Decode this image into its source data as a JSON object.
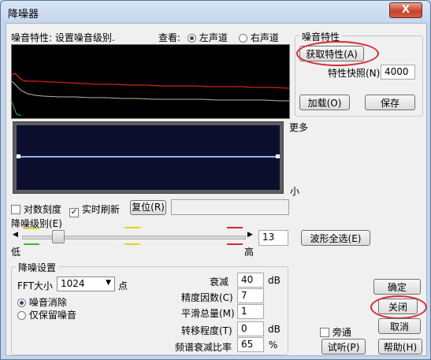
{
  "window": {
    "title": "降噪器",
    "close_glyph": "X"
  },
  "spectrum": {
    "label": "噪音特性: 设置噪音级别.",
    "view_label": "查看:",
    "left_channel": "左声道",
    "right_channel": "右声道"
  },
  "noise_profile": {
    "group_label": "噪音特性",
    "capture_button": "获取特性(A)",
    "snapshot_label": "特性快照(N)",
    "snapshot_value": "4000",
    "load_button": "加载(O)",
    "save_button": "保存"
  },
  "graph": {
    "more_label": "更多",
    "less_label": "小"
  },
  "options": {
    "log_scale": "对数刻度",
    "realtime_refresh": "实时刷新",
    "reset_button": "复位(R)"
  },
  "level": {
    "label": "降噪级别(E)",
    "low": "低",
    "high": "高",
    "value": "13",
    "select_all_button": "波形全选(E)"
  },
  "settings": {
    "group_label": "降噪设置",
    "fft_label": "FFT大小",
    "fft_value": "1024",
    "fft_unit": "点",
    "remove_noise": "噪音消除",
    "keep_noise": "仅保留噪音",
    "reduce_label": "衰减",
    "reduce_value": "40",
    "reduce_unit": "dB",
    "precision_label": "精度因数(C)",
    "precision_value": "7",
    "smoothing_label": "平滑总量(M)",
    "smoothing_value": "1",
    "transition_label": "转移程度(T)",
    "transition_value": "0",
    "transition_unit": "dB",
    "spectral_label": "频谱衰减比率",
    "spectral_value": "65",
    "spectral_unit": "%"
  },
  "buttons": {
    "ok": "确定",
    "close": "关闭",
    "cancel": "取消",
    "bypass": "旁通",
    "preview": "试听(P)",
    "help": "帮助(H)"
  }
}
